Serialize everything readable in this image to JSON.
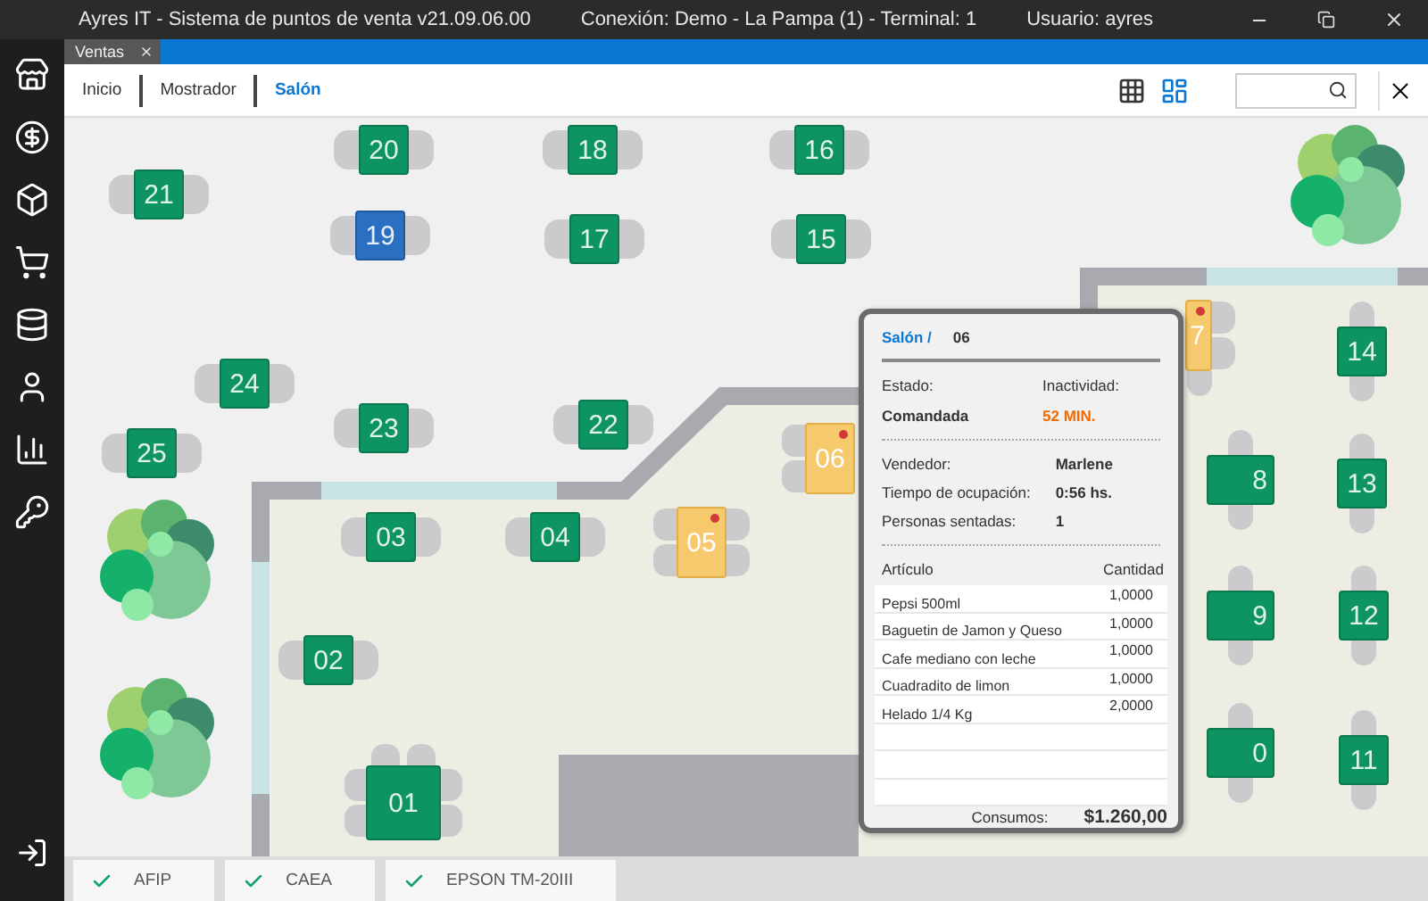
{
  "window": {
    "title": "Ayres IT - Sistema de puntos de venta v21.09.06.00",
    "connection": "Conexión: Demo - La Pampa (1) - Terminal: 1",
    "user": "Usuario: ayres"
  },
  "tabs": [
    {
      "label": "Ventas",
      "selected": true
    }
  ],
  "breadcrumbs": [
    {
      "label": "Inicio",
      "selected": false
    },
    {
      "label": "Mostrador",
      "selected": false
    },
    {
      "label": "Salón",
      "selected": true
    }
  ],
  "view_buttons": [
    {
      "kind": "grid",
      "selected": false
    },
    {
      "kind": "plan",
      "selected": true
    }
  ],
  "tables": [
    {
      "number": "21",
      "selected": false,
      "occupied": false,
      "alert": false,
      "kind": "sides"
    },
    {
      "number": "20",
      "selected": false,
      "occupied": false,
      "alert": false,
      "kind": "sides"
    },
    {
      "number": "18",
      "selected": false,
      "occupied": false,
      "alert": false,
      "kind": "sides"
    },
    {
      "number": "16",
      "selected": false,
      "occupied": false,
      "alert": false,
      "kind": "sides"
    },
    {
      "number": "19",
      "selected": true,
      "occupied": false,
      "alert": false,
      "kind": "sides"
    },
    {
      "number": "17",
      "selected": false,
      "occupied": false,
      "alert": false,
      "kind": "sides"
    },
    {
      "number": "15",
      "selected": false,
      "occupied": false,
      "alert": false,
      "kind": "sides"
    },
    {
      "number": "24",
      "selected": false,
      "occupied": false,
      "alert": false,
      "kind": "sides"
    },
    {
      "number": "23",
      "selected": false,
      "occupied": false,
      "alert": false,
      "kind": "sides"
    },
    {
      "number": "22",
      "selected": false,
      "occupied": false,
      "alert": false,
      "kind": "sides"
    },
    {
      "number": "25",
      "selected": false,
      "occupied": false,
      "alert": false,
      "kind": "sides"
    },
    {
      "number": "03",
      "selected": false,
      "occupied": false,
      "alert": false,
      "kind": "sides"
    },
    {
      "number": "04",
      "selected": false,
      "occupied": false,
      "alert": false,
      "kind": "sides"
    },
    {
      "number": "05",
      "selected": false,
      "occupied": true,
      "alert": true,
      "kind": "double"
    },
    {
      "number": "06",
      "selected": false,
      "occupied": true,
      "alert": true,
      "kind": "left"
    },
    {
      "number": "02",
      "selected": false,
      "occupied": false,
      "alert": false,
      "kind": "sides"
    },
    {
      "number": "01",
      "selected": false,
      "occupied": false,
      "alert": false,
      "kind": "quad"
    },
    {
      "number": "7",
      "selected": false,
      "occupied": true,
      "alert": true,
      "kind": "corner"
    },
    {
      "number": "8",
      "selected": false,
      "occupied": false,
      "alert": false,
      "kind": "vertical"
    },
    {
      "number": "9",
      "selected": false,
      "occupied": false,
      "alert": false,
      "kind": "vertical"
    },
    {
      "number": "0",
      "selected": false,
      "occupied": false,
      "alert": false,
      "kind": "vertical"
    },
    {
      "number": "14",
      "selected": false,
      "occupied": false,
      "alert": false,
      "kind": "vertical"
    },
    {
      "number": "13",
      "selected": false,
      "occupied": false,
      "alert": false,
      "kind": "vertical"
    },
    {
      "number": "12",
      "selected": false,
      "occupied": false,
      "alert": false,
      "kind": "vertical"
    },
    {
      "number": "11",
      "selected": false,
      "occupied": false,
      "alert": false,
      "kind": "vertical"
    }
  ],
  "detail": {
    "area": "Salón /",
    "table": "06",
    "state_label": "Estado:",
    "state": "Comandada",
    "idle_label": "Inactividad:",
    "idle": "52 MIN.",
    "seller_label": "Vendedor:",
    "seller": "Marlene",
    "time_label": "Tiempo de ocupación:",
    "time": "0:56 hs.",
    "guests_label": "Personas sentadas:",
    "guests": "1",
    "columns": [
      "Artículo",
      "Cantidad"
    ],
    "items": [
      {
        "name": "Pepsi 500ml",
        "qty": "1,0000"
      },
      {
        "name": "Baguetin de Jamon y Queso",
        "qty": "1,0000"
      },
      {
        "name": "Cafe mediano con leche",
        "qty": "1,0000"
      },
      {
        "name": "Cuadradito de limon",
        "qty": "1,0000"
      },
      {
        "name": "Helado 1/4 Kg",
        "qty": "2,0000"
      }
    ],
    "total_label": "Consumos:",
    "total": "$1.260,00"
  },
  "status_bar": [
    {
      "label": "AFIP",
      "ok": true
    },
    {
      "label": "CAEA",
      "ok": true
    },
    {
      "label": "EPSON TM-20III",
      "ok": true
    }
  ]
}
